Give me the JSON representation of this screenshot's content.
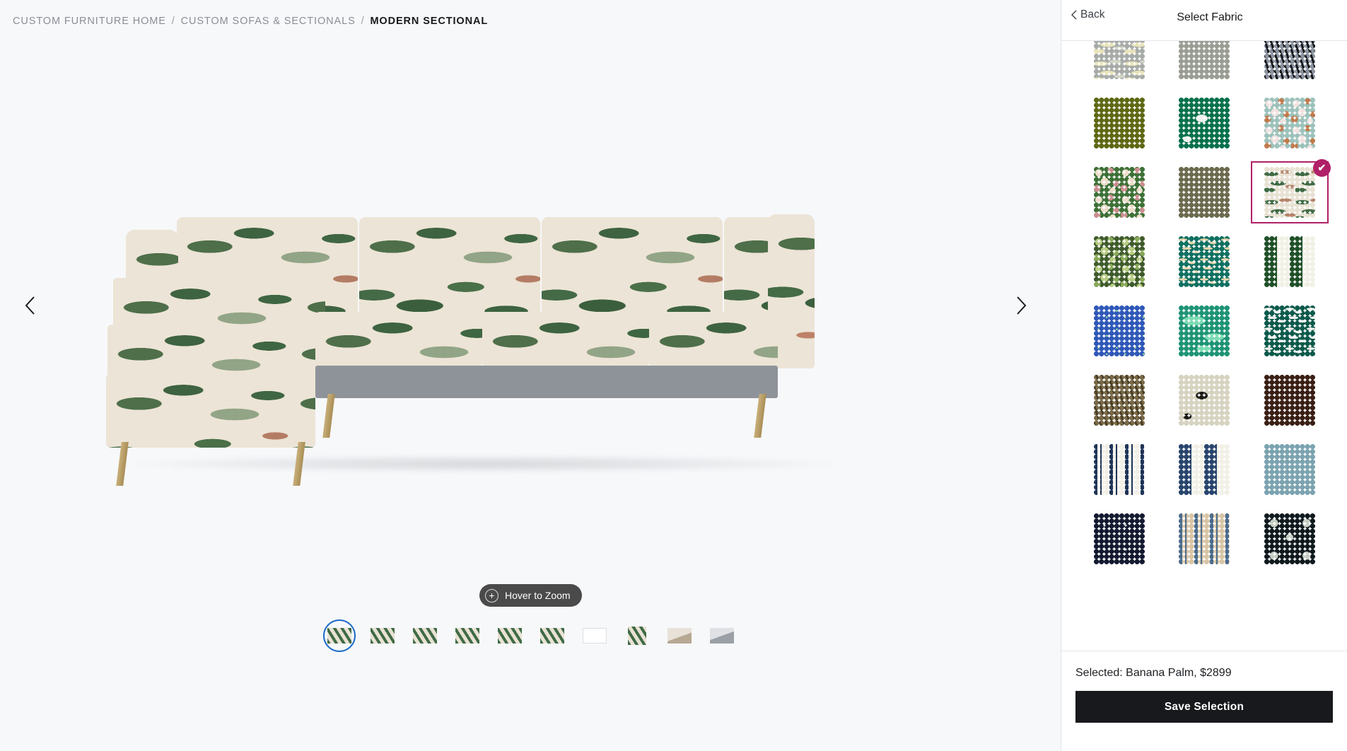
{
  "breadcrumb": {
    "items": [
      "CUSTOM FURNITURE HOME",
      "CUSTOM SOFAS & SECTIONALS",
      "MODERN SECTIONAL"
    ],
    "separator": "/"
  },
  "viewer": {
    "prev_label": "‹",
    "next_label": "›",
    "zoom_label": "Hover to Zoom",
    "zoom_icon": "plus-circle-icon",
    "product_alt": "Modern Sectional sofa in Banana Palm fabric"
  },
  "thumbnails": [
    {
      "name": "sofa-angle-front",
      "selected": true
    },
    {
      "name": "sofa-angle-three-quarter",
      "selected": false
    },
    {
      "name": "sofa-angle-side",
      "selected": false
    },
    {
      "name": "sofa-angle-back",
      "selected": false
    },
    {
      "name": "sofa-detail-corner",
      "selected": false
    },
    {
      "name": "sofa-detail-cushion",
      "selected": false
    },
    {
      "name": "sofa-dimensions-diagram",
      "selected": false
    },
    {
      "name": "fabric-closeup",
      "selected": false
    },
    {
      "name": "room-scene-living",
      "selected": false
    },
    {
      "name": "room-scene-lounge",
      "selected": false
    }
  ],
  "panel": {
    "back_label": "Back",
    "back_icon": "chevron-left-icon",
    "title": "Select Fabric",
    "selected_text": "Selected: Banana Palm, $2899",
    "save_label": "Save Selection",
    "selected_accent": "#b01f68",
    "check_icon": "check-icon"
  },
  "swatches": [
    {
      "name": "grey-botanical",
      "pattern": "leaf",
      "base": "#a7aba8",
      "a": "#e8e3b8",
      "b": "#cfd3c4",
      "selected": false
    },
    {
      "name": "sage-solid",
      "pattern": "solid",
      "base": "#9a9d94",
      "a": "#9a9d94",
      "b": "#9a9d94",
      "selected": false
    },
    {
      "name": "charcoal-tiger",
      "pattern": "zebra",
      "base": "#8b93a0",
      "a": "#14161a",
      "b": "#14161a",
      "selected": false
    },
    {
      "name": "olive-velvet",
      "pattern": "solid",
      "base": "#5f6813",
      "a": "#5f6813",
      "b": "#5f6813",
      "selected": false
    },
    {
      "name": "emerald-toile",
      "pattern": "toile",
      "base": "#07714c",
      "a": "#eef0ee",
      "b": "#eef0ee",
      "selected": false
    },
    {
      "name": "seafoam-bird-chinoiserie",
      "pattern": "foliage",
      "base": "#9cc2bb",
      "a": "#f0e2e0",
      "b": "#c07a4c",
      "selected": false
    },
    {
      "name": "green-blossom-branch",
      "pattern": "foliage",
      "base": "#3d7136",
      "a": "#ecdcc9",
      "b": "#c98e8e",
      "selected": false
    },
    {
      "name": "moss-solid",
      "pattern": "solid",
      "base": "#6b6a4e",
      "a": "#6b6a4e",
      "b": "#6b6a4e",
      "selected": false
    },
    {
      "name": "banana-palm",
      "pattern": "palm",
      "base": "#e8e2d4",
      "a": "#3f6b45",
      "b": "#b5836a",
      "selected": true
    },
    {
      "name": "oak-leaf-tapestry",
      "pattern": "foliage",
      "base": "#3f5b2c",
      "a": "#b7cc82",
      "b": "#8aa95a",
      "selected": false
    },
    {
      "name": "teal-leopard",
      "pattern": "animal",
      "base": "#0f7061",
      "a": "#e3d2a8",
      "b": "#e3d2a8",
      "selected": false
    },
    {
      "name": "forest-wide-stripe",
      "pattern": "stripe",
      "base": "#f1f1e6",
      "a": "#1f5028",
      "b": "#f1f1e6",
      "selected": false
    },
    {
      "name": "blue-ditsy-floral",
      "pattern": "speck",
      "base": "#2f58b8",
      "a": "#8fcf9a",
      "b": "#8fcf9a",
      "selected": false
    },
    {
      "name": "malachite-swirl",
      "pattern": "marble",
      "base": "#1e9475",
      "a": "#7ddcb4",
      "b": "#7ddcb4",
      "selected": false
    },
    {
      "name": "green-zebra",
      "pattern": "animal",
      "base": "#0c5a4b",
      "a": "#f2f2ee",
      "b": "#f2f2ee",
      "selected": false
    },
    {
      "name": "bronze-moire",
      "pattern": "zebra",
      "base": "#7a6a47",
      "a": "#4a3f26",
      "b": "#4a3f26",
      "selected": false
    },
    {
      "name": "cream-tiger-floral",
      "pattern": "toile",
      "base": "#d6d3c0",
      "a": "#1b1b17",
      "b": "#1b1b17",
      "selected": false
    },
    {
      "name": "espresso-velvet",
      "pattern": "solid",
      "base": "#3a1f15",
      "a": "#3a1f15",
      "b": "#3a1f15",
      "selected": false
    },
    {
      "name": "navy-ticking-stripe",
      "pattern": "stripe-thin",
      "base": "#f2f0e7",
      "a": "#1f3458",
      "b": "#f2f0e7",
      "selected": false
    },
    {
      "name": "navy-wide-stripe",
      "pattern": "stripe",
      "base": "#f2f0e7",
      "a": "#28456d",
      "b": "#f2f0e7",
      "selected": false
    },
    {
      "name": "slate-blue-linen",
      "pattern": "solid",
      "base": "#7ba3b0",
      "a": "#7ba3b0",
      "b": "#7ba3b0",
      "selected": false
    },
    {
      "name": "midnight-navy-grommet",
      "pattern": "dots",
      "base": "#141a30",
      "a": "#c9cbc6",
      "b": "#c9cbc6",
      "selected": false
    },
    {
      "name": "blue-sand-awning-stripe",
      "pattern": "stripe-thin",
      "base": "#d8c5a6",
      "a": "#4a6c8e",
      "b": "#d8c5a6",
      "selected": false
    },
    {
      "name": "indigo-shibori-ikat",
      "pattern": "ikat",
      "base": "#101a1e",
      "a": "#c6cec4",
      "b": "#c6cec4",
      "selected": false
    }
  ]
}
